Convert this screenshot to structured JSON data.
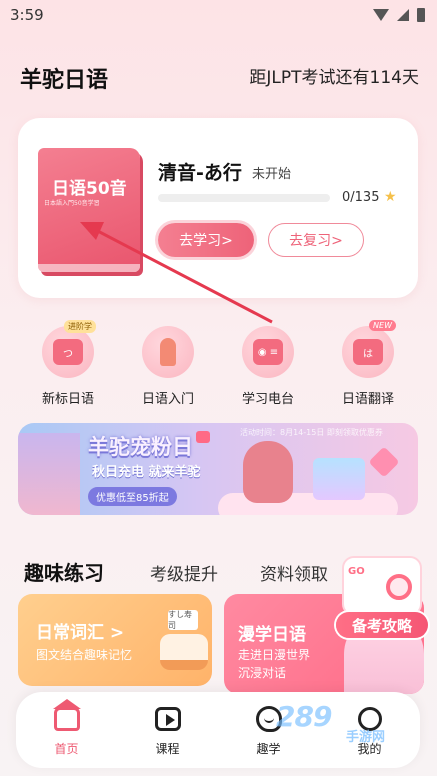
{
  "status": {
    "time": "3:59"
  },
  "header": {
    "app_title": "羊驼日语",
    "exam_countdown": "距JLPT考试还有114天"
  },
  "progress_card": {
    "book_title": "日语50音",
    "book_subtitle": "日本語入門50音学習",
    "lesson_title": "清音-あ行",
    "lesson_status": "未开始",
    "progress_done": 0,
    "progress_total": 135,
    "progress_text": "0/135",
    "study_button": "去学习>",
    "review_button": "去复习>"
  },
  "quick_entries": [
    {
      "label": "新标日语",
      "tag": "进阶学",
      "icon": "book-badge-icon"
    },
    {
      "label": "日语入门",
      "tag": "",
      "icon": "rocket-icon"
    },
    {
      "label": "学习电台",
      "tag": "",
      "icon": "radio-icon"
    },
    {
      "label": "日语翻译",
      "tag": "NEW",
      "icon": "translate-icon"
    }
  ],
  "banner": {
    "title": "羊驼宠粉日",
    "slogan": "秋日充电  就来羊驼",
    "discount": "优惠低至85折起",
    "date": "活动时间：8月14-15日    即刻领取优惠券"
  },
  "practice_tabs": [
    "趣味练习",
    "考级提升",
    "资料领取"
  ],
  "vocab_card": {
    "title": "日常词汇 >",
    "desc": "图文结合趣味记忆",
    "sign": "すし寿司"
  },
  "manga_card": {
    "title": "漫学日语",
    "desc1": "走进日漫世界",
    "desc2": "沉浸对话"
  },
  "exam_strategy": {
    "label": "备考攻略",
    "sign": "GO"
  },
  "bottom_nav": [
    {
      "label": "首页",
      "icon": "home-icon",
      "active": true
    },
    {
      "label": "课程",
      "icon": "play-icon",
      "active": false
    },
    {
      "label": "趣学",
      "icon": "fun-icon",
      "active": false
    },
    {
      "label": "我的",
      "icon": "user-icon",
      "active": false
    }
  ],
  "watermark": {
    "text": "289",
    "sub": "手游网"
  },
  "colors": {
    "accent": "#ee5a72",
    "progress": "#f06a80",
    "star": "#f5c04a",
    "vocab": "#ffb36a"
  }
}
